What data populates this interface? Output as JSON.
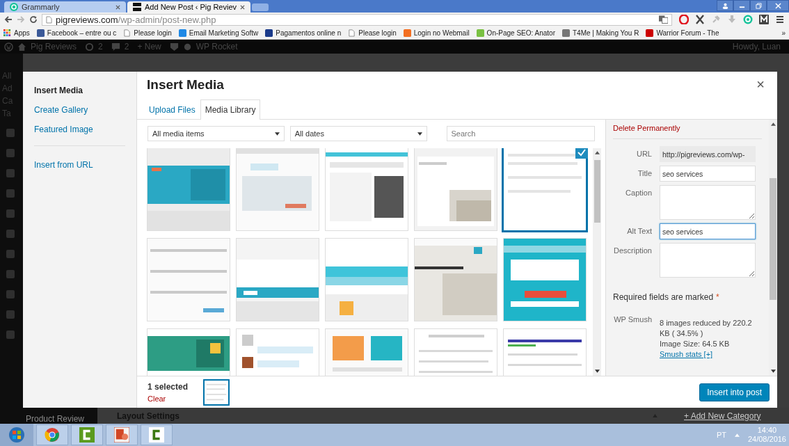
{
  "browser": {
    "tabs": [
      {
        "title": "Grammarly",
        "selected": false
      },
      {
        "title": "Add New Post ‹ Pig Reviev",
        "selected": true
      }
    ],
    "url": {
      "host": "pigreviews.com",
      "path": "/wp-admin/post-new.php"
    },
    "bookmarks": [
      "Apps",
      "Facebook – entre ou c",
      "Please login",
      "Email Marketing Softw",
      "Pagamentos online n",
      "Please login",
      "Login no Webmail",
      "On-Page SEO: Anator",
      "T4Me | Making You R",
      "Warrior Forum - The"
    ],
    "bookmarks_more": "»"
  },
  "admin_bar": {
    "site": "Pig Reviews",
    "updates": "2",
    "comments": "2",
    "new": "+ New",
    "plugin": "WP Rocket",
    "greeting": "Howdy, Luan"
  },
  "admin_menu": [
    "All",
    "Ad",
    "Ca",
    "Ta"
  ],
  "modal": {
    "menu": [
      [
        {
          "label": "Insert Media",
          "selected": true
        },
        {
          "label": "Create Gallery",
          "selected": false
        },
        {
          "label": "Featured Image",
          "selected": false
        }
      ],
      [
        {
          "label": "Insert from URL",
          "selected": false
        }
      ]
    ],
    "title": "Insert Media",
    "close": "×",
    "tabs": [
      {
        "label": "Upload Files",
        "selected": false
      },
      {
        "label": "Media Library",
        "selected": true
      }
    ],
    "filters": [
      "All media items",
      "All dates"
    ],
    "search": {
      "placeholder": "Search"
    },
    "media_items": [
      {
        "selected": false
      },
      {
        "selected": false
      },
      {
        "selected": false
      },
      {
        "selected": false
      },
      {
        "selected": true
      },
      {
        "selected": false
      },
      {
        "selected": false
      },
      {
        "selected": false
      },
      {
        "selected": false
      },
      {
        "selected": false
      },
      {
        "selected": false
      },
      {
        "selected": false
      },
      {
        "selected": false
      },
      {
        "selected": false
      },
      {
        "selected": false
      }
    ],
    "details": {
      "delete": "Delete Permanently",
      "fields": [
        {
          "label": "URL",
          "value": "http://pigreviews.com/wp-",
          "kind": "input",
          "readonly": true,
          "focused": false
        },
        {
          "label": "Title",
          "value": "seo services",
          "kind": "input",
          "readonly": false,
          "focused": false
        },
        {
          "label": "Caption",
          "kind": "textarea",
          "readonly": false,
          "focused": false
        },
        {
          "label": "Alt Text",
          "value": "seo services",
          "kind": "input",
          "readonly": false,
          "focused": true
        },
        {
          "label": "Description",
          "kind": "textarea",
          "readonly": false,
          "focused": false
        }
      ],
      "required_note": "Required fields are marked",
      "required_mark": "*",
      "smush": {
        "label": "WP Smush",
        "lines": [
          "8 images reduced by 220.2 KB ( 34.5% )",
          "Image Size: 64.5 KB"
        ],
        "link": "Smush stats [+]"
      }
    },
    "footer": {
      "count": "1 selected",
      "clear": "Clear",
      "button": "Insert into post"
    }
  },
  "background": {
    "sidebar_item": "Product Review",
    "section": "Layout Settings",
    "link": "+ Add New Category"
  },
  "taskbar": {
    "language": "PT",
    "time": "14:40",
    "date": "24/08/2016"
  }
}
